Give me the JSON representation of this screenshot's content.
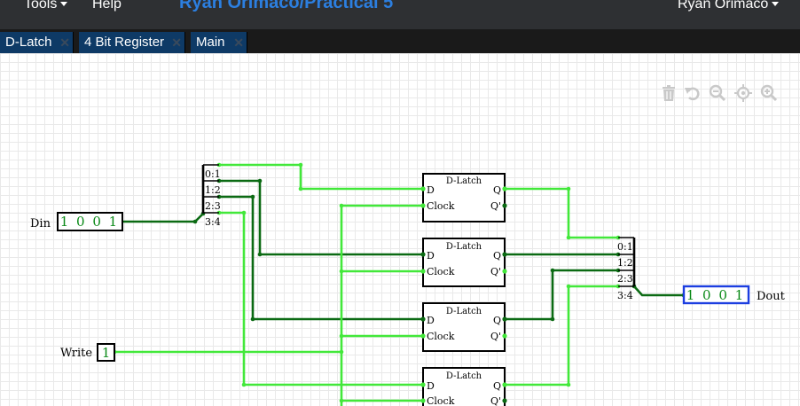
{
  "menu": {
    "tools": "Tools",
    "help": "Help",
    "user": "Ryan Orimaco"
  },
  "project_title": "Ryan Orimaco/Practical 5",
  "tabs": [
    {
      "label": "D-Latch"
    },
    {
      "label": "4 Bit Register"
    },
    {
      "label": "Main"
    }
  ],
  "tab_close_glyph": "✕",
  "toolbar_icons": [
    "trash-icon",
    "undo-icon",
    "zoom-out-icon",
    "center-icon",
    "zoom-in-icon"
  ],
  "circuit": {
    "din_label": "Din",
    "din_value": "1 0 0 1",
    "write_label": "Write",
    "write_value": "1",
    "dout_label": "Dout",
    "dout_value": "1 0 0 1",
    "splitter_in": [
      "0:1",
      "1:2",
      "2:3",
      "3:4"
    ],
    "splitter_out": [
      "0:1",
      "1:2",
      "2:3",
      "3:4"
    ],
    "latch_title": "D-Latch",
    "latch_d": "D",
    "latch_clock": "Clock",
    "latch_q": "Q",
    "latch_qbar": "Q'"
  },
  "colors": {
    "wire_on": "#42e83a",
    "wire_off": "#0b6a13",
    "dout_border": "#1c3ee0",
    "title": "#2c7fe0",
    "tab": "#0e3a66"
  }
}
